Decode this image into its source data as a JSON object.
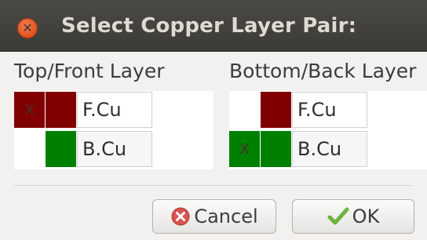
{
  "window": {
    "title": "Select Copper Layer Pair:"
  },
  "top_panel": {
    "label": "Top/Front Layer",
    "rows": [
      {
        "layer": "F.Cu",
        "color": "#800000",
        "selected": true,
        "marker": "X"
      },
      {
        "layer": "B.Cu",
        "color": "#008000",
        "selected": false,
        "marker": ""
      }
    ]
  },
  "bottom_panel": {
    "label": "Bottom/Back Layer",
    "rows": [
      {
        "layer": "F.Cu",
        "color": "#800000",
        "selected": false,
        "marker": ""
      },
      {
        "layer": "B.Cu",
        "color": "#008000",
        "selected": true,
        "marker": "X"
      }
    ]
  },
  "buttons": {
    "cancel_label": "Cancel",
    "ok_label": "OK"
  },
  "colors": {
    "titlebar": "#3c3b37",
    "close": "#e0531d",
    "front_copper": "#800000",
    "back_copper": "#008000",
    "cancel_icon": "#d9534f",
    "ok_icon": "#6cb33f"
  },
  "icons": {
    "close": "close-icon",
    "cancel": "cancel-icon",
    "ok": "checkmark-icon"
  }
}
